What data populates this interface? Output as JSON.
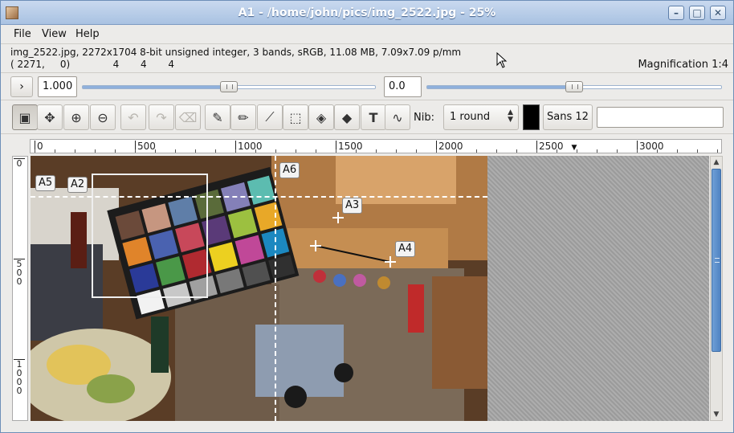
{
  "window": {
    "title": "A1 - /home/john/pics/img_2522.jpg - 25%",
    "buttons": [
      "–",
      "□",
      "✕"
    ]
  },
  "menu": [
    "File",
    "View",
    "Help"
  ],
  "info": {
    "image_desc": "img_2522.jpg, 2272x1704 8-bit unsigned integer, 3 bands, sRGB, 11.08 MB, 7.09x7.09 p/mm",
    "pixel_readout": "( 2271,     0)              4       4       4",
    "magnification": "Magnification 1:4"
  },
  "display_controls": {
    "expand_glyph": "›",
    "scale_value": "1.000",
    "offset_value": "0.0",
    "scale_level": 0.5,
    "offset_level": 0.5
  },
  "toolbar": {
    "tools": [
      {
        "name": "select",
        "glyph": "▣",
        "active": true
      },
      {
        "name": "pan",
        "glyph": "✥"
      },
      {
        "name": "zoom-in",
        "glyph": "⊕"
      },
      {
        "name": "zoom-out",
        "glyph": "⊖"
      },
      {
        "name": "undo",
        "glyph": "↶",
        "disabled": true
      },
      {
        "name": "redo",
        "glyph": "↷",
        "disabled": true
      },
      {
        "name": "clear",
        "glyph": "⌫",
        "disabled": true
      },
      {
        "name": "dropper",
        "glyph": "✎"
      },
      {
        "name": "pen",
        "glyph": "✏"
      },
      {
        "name": "line",
        "glyph": "⟋"
      },
      {
        "name": "rect-select",
        "glyph": "⬚"
      },
      {
        "name": "flood-fill",
        "glyph": "◈"
      },
      {
        "name": "blob-fill",
        "glyph": "◆"
      },
      {
        "name": "text",
        "glyph": "T"
      },
      {
        "name": "smudge",
        "glyph": "∿"
      }
    ],
    "nib_label": "Nib:",
    "nib_value": "1 round",
    "ink_color": "#000000",
    "font_label": "Sans 12",
    "text_value": ""
  },
  "ruler_top": {
    "labels": [
      "0",
      "500",
      "1000",
      "1500",
      "2000",
      "2500",
      "3000"
    ],
    "marker": "▼"
  },
  "ruler_left": {
    "labels": [
      "0",
      "500",
      "1000"
    ]
  },
  "regions": [
    "A5",
    "A2",
    "A6",
    "A3",
    "A4"
  ]
}
